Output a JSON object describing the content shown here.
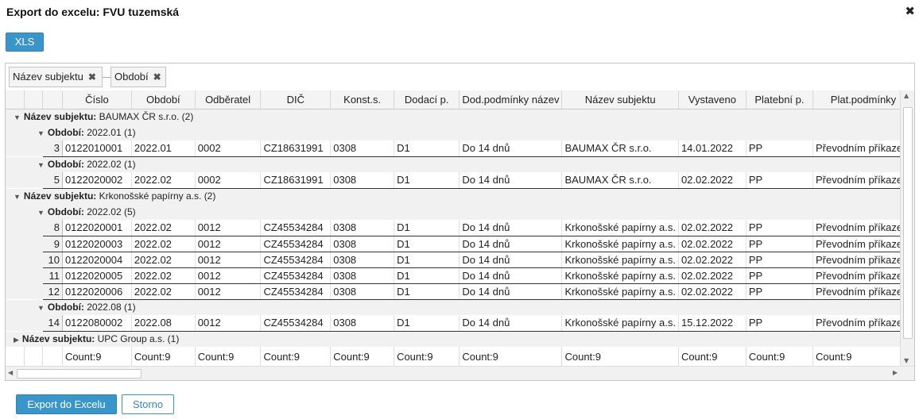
{
  "dialog": {
    "title": "Export do excelu: FVU tuzemská",
    "close_glyph": "✖"
  },
  "toolbar": {
    "xls_label": "XLS"
  },
  "group_chips": [
    {
      "label": "Název subjektu",
      "remove": "✖"
    },
    {
      "label": "Období",
      "remove": "✖"
    }
  ],
  "columns": [
    "Číslo",
    "Období",
    "Odběratel",
    "DIČ",
    "Konst.s.",
    "Dodací p.",
    "Dod.podmínky název",
    "Název subjektu",
    "Vystaveno",
    "Platební p.",
    "Plat.podmínky"
  ],
  "rows": [
    {
      "type": "g1",
      "label": "Název subjektu:",
      "value": "BAUMAX ČR s.r.o. (2)",
      "expanded": true
    },
    {
      "type": "g2",
      "label": "Období:",
      "value": "2022.01 (1)"
    },
    {
      "type": "data",
      "num": "3",
      "cells": [
        "0122010001",
        "2022.01",
        "0002",
        "CZ18631991",
        "0308",
        "D1",
        "Do 14 dnů",
        "BAUMAX ČR s.r.o.",
        "14.01.2022",
        "PP",
        "Převodním příkazem"
      ]
    },
    {
      "type": "g2",
      "label": "Období:",
      "value": "2022.02 (1)"
    },
    {
      "type": "data",
      "num": "5",
      "cells": [
        "0122020002",
        "2022.02",
        "0002",
        "CZ18631991",
        "0308",
        "D1",
        "Do 14 dnů",
        "BAUMAX ČR s.r.o.",
        "02.02.2022",
        "PP",
        "Převodním příkazem"
      ]
    },
    {
      "type": "g1",
      "label": "Název subjektu:",
      "value": "Krkonošské papírny a.s. (2)",
      "expanded": true
    },
    {
      "type": "g2",
      "label": "Období:",
      "value": "2022.02 (5)"
    },
    {
      "type": "data",
      "num": "8",
      "cells": [
        "0122020001",
        "2022.02",
        "0012",
        "CZ45534284",
        "0308",
        "D1",
        "Do 14 dnů",
        "Krkonošské papírny a.s.",
        "02.02.2022",
        "PP",
        "Převodním příkazem"
      ]
    },
    {
      "type": "data",
      "num": "9",
      "cells": [
        "0122020003",
        "2022.02",
        "0012",
        "CZ45534284",
        "0308",
        "D1",
        "Do 14 dnů",
        "Krkonošské papírny a.s.",
        "02.02.2022",
        "PP",
        "Převodním příkazem"
      ]
    },
    {
      "type": "data",
      "num": "10",
      "cells": [
        "0122020004",
        "2022.02",
        "0012",
        "CZ45534284",
        "0308",
        "D1",
        "Do 14 dnů",
        "Krkonošské papírny a.s.",
        "02.02.2022",
        "PP",
        "Převodním příkazem"
      ]
    },
    {
      "type": "data",
      "num": "11",
      "cells": [
        "0122020005",
        "2022.02",
        "0012",
        "CZ45534284",
        "0308",
        "D1",
        "Do 14 dnů",
        "Krkonošské papírny a.s.",
        "02.02.2022",
        "PP",
        "Převodním příkazem"
      ]
    },
    {
      "type": "data",
      "num": "12",
      "cells": [
        "0122020006",
        "2022.02",
        "0012",
        "CZ45534284",
        "0308",
        "D1",
        "Do 14 dnů",
        "Krkonošské papírny a.s.",
        "02.02.2022",
        "PP",
        "Převodním příkazem"
      ]
    },
    {
      "type": "g2",
      "label": "Období:",
      "value": "2022.08 (1)"
    },
    {
      "type": "data",
      "num": "14",
      "cells": [
        "0122080002",
        "2022.08",
        "0012",
        "CZ45534284",
        "0308",
        "D1",
        "Do 14 dnů",
        "Krkonošské papírny a.s.",
        "15.12.2022",
        "PP",
        "Převodním příkazem"
      ]
    },
    {
      "type": "g1",
      "label": "Název subjektu:",
      "value": "UPC Group a.s. (1)",
      "expanded": false
    }
  ],
  "footer": [
    "Count:9",
    "Count:9",
    "Count:9",
    "Count:9",
    "Count:9",
    "Count:9",
    "Count:9",
    "Count:9",
    "Count:9",
    "Count:9",
    "Count:9"
  ],
  "icons": {
    "expanded": "▼",
    "collapsed": "▶",
    "scroll_up": "▲",
    "scroll_down": "▼",
    "scroll_left": "◀",
    "scroll_right": "▶"
  },
  "buttons": {
    "export_label": "Export do Excelu",
    "cancel_label": "Storno"
  },
  "colors": {
    "accent": "#3a95c8"
  }
}
